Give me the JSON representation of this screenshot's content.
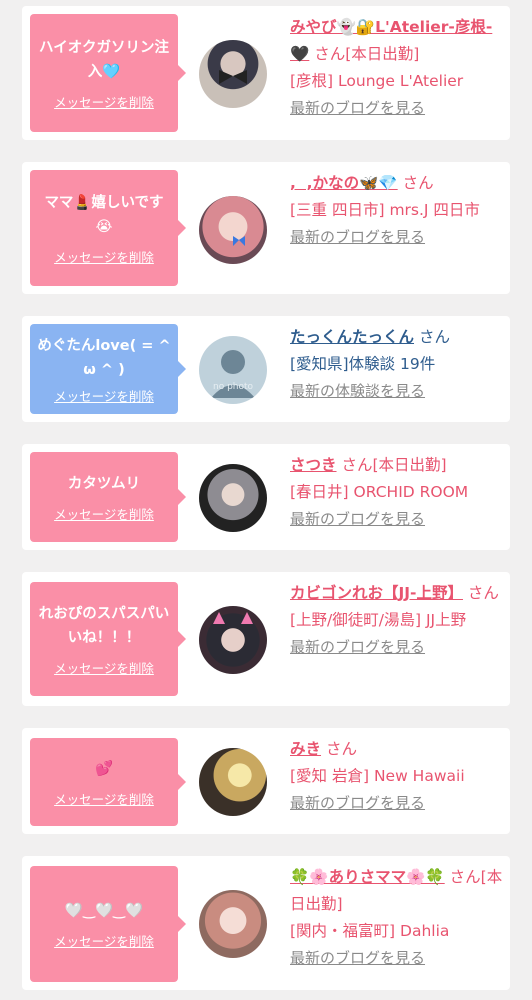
{
  "cards": [
    {
      "message": "ハイオクガソリン注入🩵",
      "delete_label": "メッセージを削除",
      "name": "みやび👻🔐L'Atelier-彦根-🖤",
      "suffix": "さん[本日出勤]",
      "shop": "[彦根] Lounge L'Atelier",
      "more": "最新のブログを見る"
    },
    {
      "message": "ママ💄嬉しいです😭",
      "delete_label": "メッセージを削除",
      "name": ",⁠ ⁠ ⁠,かなの🦋💎",
      "suffix": "さん",
      "shop": "[三重 四日市] mrs.J 四日市",
      "more": "最新のブログを見る"
    },
    {
      "message": "めぐたんlove( = ^ ω ^ )",
      "delete_label": "メッセージを削除",
      "name": "たっくんたっくん",
      "suffix": "さん",
      "shop": "[愛知県]体験談 19件",
      "more": "最新の体験談を見る",
      "avatar_text": "no photo"
    },
    {
      "message": "カタツムリ",
      "delete_label": "メッセージを削除",
      "name": "さつき",
      "suffix": "さん[本日出勤]",
      "shop": "[春日井] ORCHID ROOM",
      "more": "最新のブログを見る"
    },
    {
      "message": "れおぴのスパスパいいね！！！",
      "delete_label": "メッセージを削除",
      "name": "カビゴンれお【JJ-上野】",
      "suffix": "さん",
      "shop": "[上野/御徒町/湯島] JJ上野",
      "more": "最新のブログを見る"
    },
    {
      "message": "💕",
      "delete_label": "メッセージを削除",
      "name": "みき",
      "suffix": "さん",
      "shop": "[愛知 岩倉] New Hawaii",
      "more": "最新のブログを見る"
    },
    {
      "message": "🤍‿🤍‿🤍",
      "delete_label": "メッセージを削除",
      "name": "🍀🌸ありさママ🌸🍀",
      "suffix": "さん[本日出勤]",
      "shop": "[関内・福富町] Dahlia",
      "more": "最新のブログを見る"
    }
  ],
  "colors": {
    "pink_bubble": "#fa8fa7",
    "blue_bubble": "#8ab4f2",
    "pink_text": "#e8546f",
    "blue_text": "#2f5d8e"
  }
}
